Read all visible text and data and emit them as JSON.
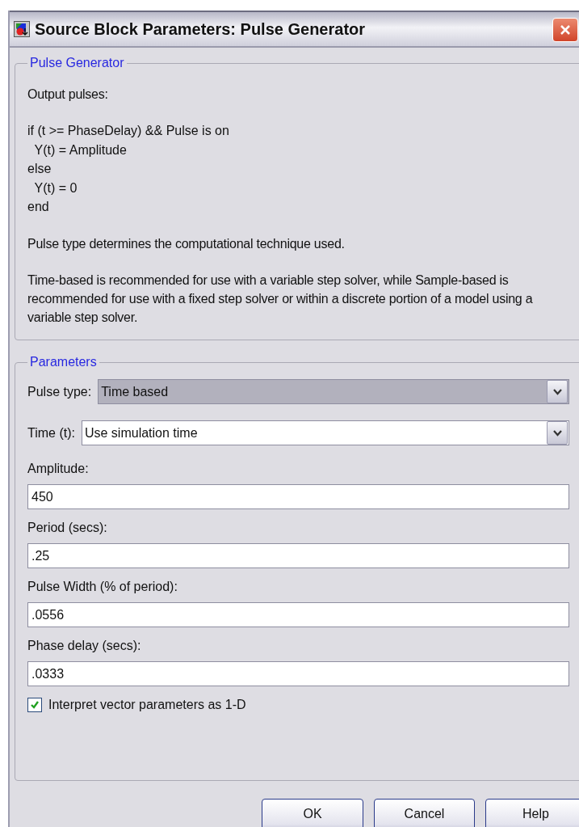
{
  "window": {
    "title": "Source Block Parameters: Pulse Generator"
  },
  "description": {
    "legend": "Pulse Generator",
    "lines": [
      {
        "kind": "text",
        "text": "Output pulses:"
      },
      {
        "kind": "gap"
      },
      {
        "kind": "code",
        "text": "if (t >= PhaseDelay) && Pulse is on"
      },
      {
        "kind": "code",
        "text": "  Y(t) = Amplitude"
      },
      {
        "kind": "code",
        "text": "else"
      },
      {
        "kind": "code",
        "text": "  Y(t) = 0"
      },
      {
        "kind": "code",
        "text": "end"
      },
      {
        "kind": "gap"
      },
      {
        "kind": "text",
        "text": "Pulse type determines the computational technique used."
      },
      {
        "kind": "gap"
      },
      {
        "kind": "text",
        "text": "Time-based is recommended for use with a variable step solver, while Sample-based is recommended for use with a fixed step solver or within a discrete portion of a model using a variable step solver."
      }
    ]
  },
  "parameters": {
    "legend": "Parameters",
    "fields": [
      {
        "kind": "dropdown",
        "label": "Pulse type:",
        "value": "Time based",
        "focused": true
      },
      {
        "kind": "dropdown",
        "label": "Time (t):",
        "value": "Use simulation time",
        "focused": false
      },
      {
        "kind": "text",
        "label": "Amplitude:",
        "value": "450"
      },
      {
        "kind": "text",
        "label": "Period (secs):",
        "value": ".25"
      },
      {
        "kind": "text",
        "label": "Pulse Width (% of period):",
        "value": ".0556"
      },
      {
        "kind": "text",
        "label": "Phase delay (secs):",
        "value": ".0333"
      }
    ],
    "checkbox": {
      "label": "Interpret vector parameters as 1-D",
      "checked": true
    }
  },
  "buttons": [
    "OK",
    "Cancel",
    "Help"
  ]
}
